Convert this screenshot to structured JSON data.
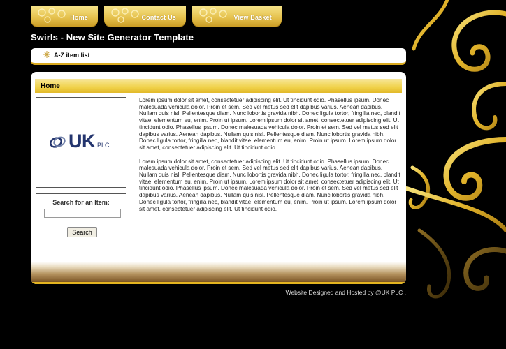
{
  "nav": {
    "tabs": [
      {
        "label": "Home"
      },
      {
        "label": "Contact Us"
      },
      {
        "label": "View Basket"
      }
    ]
  },
  "site": {
    "title": "Swirls - New Site Generator Template"
  },
  "az_bar": {
    "label": "A-Z item list",
    "icon": "sparkle-icon"
  },
  "main": {
    "heading": "Home",
    "paragraphs": [
      "Lorem ipsum dolor sit amet, consectetuer adipiscing elit. Ut tincidunt odio. Phasellus ipsum. Donec malesuada vehicula dolor. Proin et sem. Sed vel metus sed elit dapibus varius. Aenean dapibus. Nullam quis nisl. Pellentesque diam. Nunc lobortis gravida nibh. Donec ligula tortor, fringilla nec, blandit vitae, elementum eu, enim. Proin ut ipsum. Lorem ipsum dolor sit amet, consectetuer adipiscing elit. Ut tincidunt odio. Phasellus ipsum. Donec malesuada vehicula dolor. Proin et sem. Sed vel metus sed elit dapibus varius. Aenean dapibus. Nullam quis nisl. Pellentesque diam. Nunc lobortis gravida nibh. Donec ligula tortor, fringilla nec, blandit vitae, elementum eu, enim. Proin ut ipsum. Lorem ipsum dolor sit amet, consectetuer adipiscing elit. Ut tincidunt odio.",
      "Lorem ipsum dolor sit amet, consectetuer adipiscing elit. Ut tincidunt odio. Phasellus ipsum. Donec malesuada vehicula dolor. Proin et sem. Sed vel metus sed elit dapibus varius. Aenean dapibus. Nullam quis nisl. Pellentesque diam. Nunc lobortis gravida nibh. Donec ligula tortor, fringilla nec, blandit vitae, elementum eu, enim. Proin ut ipsum. Lorem ipsum dolor sit amet, consectetuer adipiscing elit. Ut tincidunt odio. Phasellus ipsum. Donec malesuada vehicula dolor. Proin et sem. Sed vel metus sed elit dapibus varius. Aenean dapibus. Nullam quis nisl. Pellentesque diam. Nunc lobortis gravida nibh. Donec ligula tortor, fringilla nec, blandit vitae, elementum eu, enim. Proin ut ipsum. Lorem ipsum dolor sit amet, consectetuer adipiscing elit. Ut tincidunt odio."
    ]
  },
  "logo": {
    "uk": "UK",
    "plc": "PLC"
  },
  "search": {
    "title": "Search for an Item:",
    "value": "",
    "placeholder": "",
    "button_label": "Search"
  },
  "footer": {
    "credit": "Website Designed and Hosted by @UK PLC ."
  },
  "colors": {
    "background": "#000000",
    "accent_gold": "#e6c24e",
    "logo_blue": "#24356e"
  }
}
